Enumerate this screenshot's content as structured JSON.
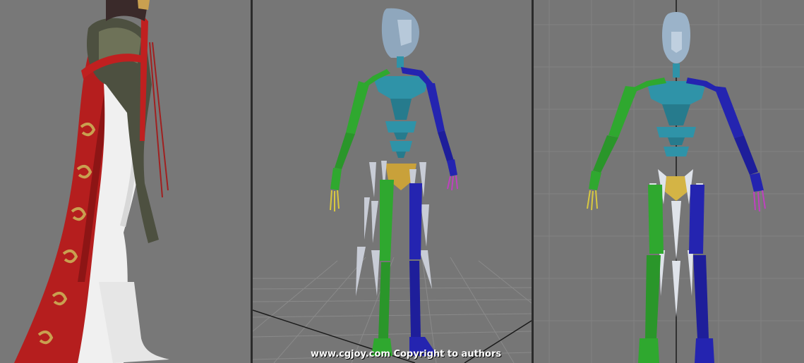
{
  "watermark": {
    "text": "www.cgjoy.com  Copyright to authors"
  },
  "viewports": {
    "left": {
      "content": "character-model-closeup"
    },
    "middle": {
      "content": "skeleton-perspective"
    },
    "right": {
      "content": "skeleton-front"
    }
  },
  "colors": {
    "viewport_bg": "#757575",
    "divider": "#2b2b2b",
    "bone_left_limbs": "#2fa82f",
    "bone_right_limbs": "#2424b0",
    "bone_spine": "#2f93a8",
    "head": "#9bb3c9",
    "pelvis": "#c9a13a",
    "skirt_spikes": "#c8ccd6",
    "robe_red": "#b51e1e",
    "robe_white": "#f2f2f2"
  }
}
